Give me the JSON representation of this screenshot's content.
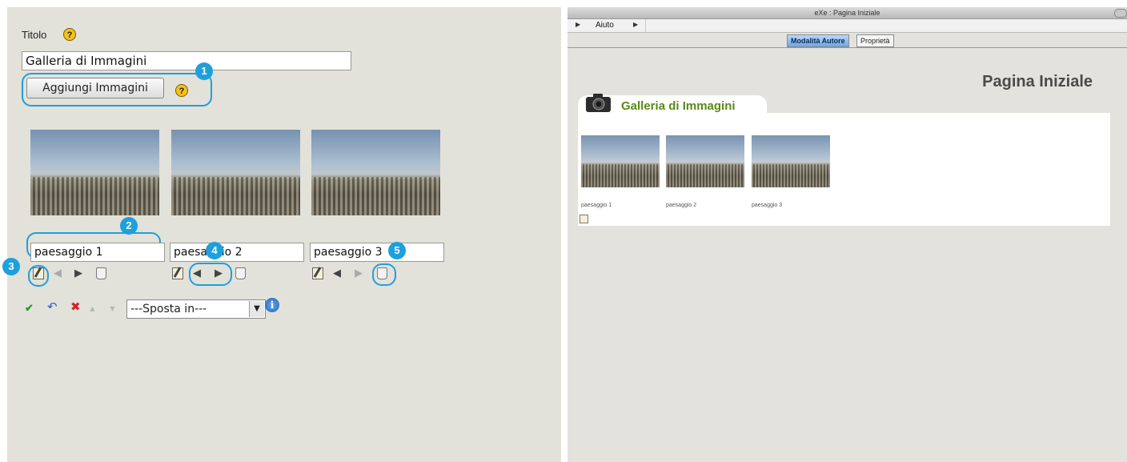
{
  "editor": {
    "title_label": "Titolo",
    "title_value": "Galleria di Immagini",
    "add_images_button": "Aggiungi Immagini",
    "help_glyph": "?",
    "images": [
      {
        "caption": "paesaggio 1"
      },
      {
        "caption": "paesaggio 2"
      },
      {
        "caption": "paesaggio 3"
      }
    ],
    "icons": {
      "edit": "edit-icon",
      "move_left": "arrow-left-icon",
      "move_right": "arrow-right-icon",
      "delete": "trash-icon"
    },
    "toolbar": {
      "done": "✔",
      "undo": "↶",
      "delete": "✖",
      "up": "▲",
      "down": "▼",
      "move_select": "---Sposta in---",
      "info": "i"
    },
    "callouts": [
      "1",
      "2",
      "3",
      "4",
      "5"
    ]
  },
  "preview": {
    "window_title": "eXe : Pagina Iniziale",
    "menu": {
      "aiuto": "Aiuto"
    },
    "tabs": {
      "authoring": "Modalità Autore",
      "properties": "Proprietà"
    },
    "page_title": "Pagina Iniziale",
    "idevice_title": "Galleria di Immagini",
    "captions": [
      "paesaggio 1",
      "paesaggio 2",
      "paesaggio 3"
    ]
  },
  "colors": {
    "callout": "#1ea0dc",
    "idevice_title": "#5a8a14",
    "panel_bg": "#e2e1da"
  }
}
